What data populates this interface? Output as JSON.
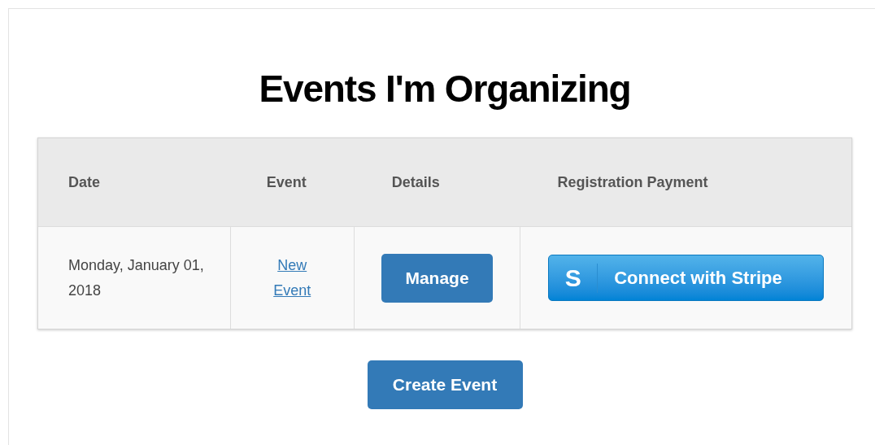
{
  "heading": "Events I'm Organizing",
  "table": {
    "columns": [
      "Date",
      "Event",
      "Details",
      "Registration Payment"
    ],
    "rows": [
      {
        "date": "Monday, January 01, 2018",
        "event": "New Event",
        "details_button": "Manage",
        "payment_button": {
          "logo_letter": "S",
          "label": "Connect with Stripe"
        }
      }
    ]
  },
  "create_button": "Create Event"
}
